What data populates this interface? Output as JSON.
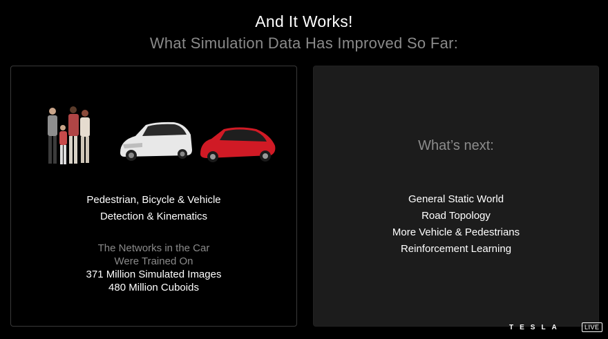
{
  "header": {
    "title": "And It Works!",
    "subtitle": "What Simulation Data Has Improved So Far:"
  },
  "left_panel": {
    "detection_lines": [
      "Pedestrian, Bicycle & Vehicle",
      "Detection & Kinematics"
    ],
    "training_lines_gray": [
      "The Networks in the Car",
      "Were Trained On"
    ],
    "training_lines_white": [
      "371 Million Simulated Images",
      "480 Million Cuboids"
    ],
    "illustration_icons": [
      "pedestrians-group-icon",
      "white-car-icon",
      "red-car-icon"
    ]
  },
  "right_panel": {
    "heading": "What’s next:",
    "items": [
      "General Static World",
      "Road Topology",
      "More Vehicle & Pedestrians",
      "Reinforcement Learning"
    ]
  },
  "footer": {
    "brand": "TESLA",
    "badge": "LIVE"
  },
  "colors": {
    "background": "#000000",
    "subtitle_gray": "#8a8a8a",
    "right_panel_bg": "#1c1c1c",
    "car_red": "#d01a25",
    "car_white": "#e8e8e8"
  }
}
